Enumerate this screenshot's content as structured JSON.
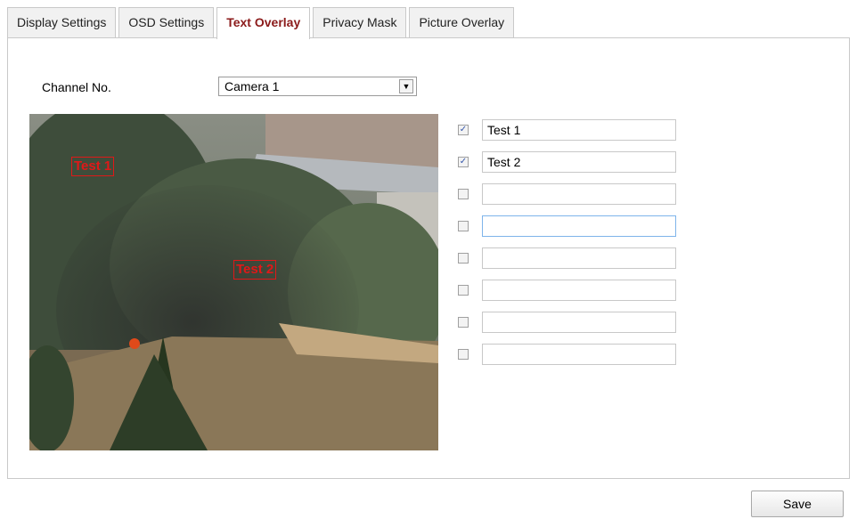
{
  "tabs": [
    {
      "label": "Display Settings",
      "active": false
    },
    {
      "label": "OSD Settings",
      "active": false
    },
    {
      "label": "Text Overlay",
      "active": true
    },
    {
      "label": "Privacy Mask",
      "active": false
    },
    {
      "label": "Picture Overlay",
      "active": false
    }
  ],
  "channel": {
    "label": "Channel No.",
    "value": "Camera 1"
  },
  "preview": {
    "overlays": [
      "Test 1",
      "Test 2"
    ]
  },
  "overlay_rows": [
    {
      "checked": true,
      "text": "Test 1"
    },
    {
      "checked": true,
      "text": "Test 2"
    },
    {
      "checked": false,
      "text": ""
    },
    {
      "checked": false,
      "text": ""
    },
    {
      "checked": false,
      "text": ""
    },
    {
      "checked": false,
      "text": ""
    },
    {
      "checked": false,
      "text": ""
    },
    {
      "checked": false,
      "text": ""
    }
  ],
  "save_label": "Save",
  "colors": {
    "active_tab": "#8b1a1a",
    "overlay_text": "#e01818",
    "border": "#c9c9c9"
  }
}
